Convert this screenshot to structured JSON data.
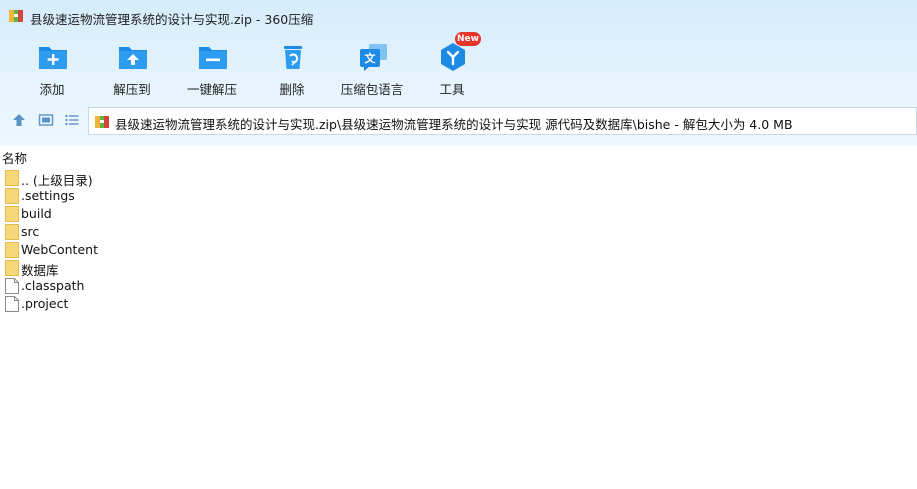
{
  "window": {
    "title": "县级速运物流管理系统的设计与实现.zip - 360压缩"
  },
  "toolbar": {
    "items": [
      {
        "label": "添加",
        "icon": "add-folder-icon"
      },
      {
        "label": "解压到",
        "icon": "extract-to-icon"
      },
      {
        "label": "一键解压",
        "icon": "one-click-extract-icon"
      },
      {
        "label": "删除",
        "icon": "recycle-bin-icon"
      },
      {
        "label": "压缩包语言",
        "icon": "language-icon"
      },
      {
        "label": "工具",
        "icon": "tools-icon"
      }
    ],
    "new_badge": "New"
  },
  "address": {
    "path": "县级速运物流管理系统的设计与实现.zip\\县级速运物流管理系统的设计与实现 源代码及数据库\\bishe - 解包大小为 4.0 MB"
  },
  "list": {
    "header_name": "名称",
    "files": [
      {
        "name": ".. (上级目录)",
        "type": "folder"
      },
      {
        "name": ".settings",
        "type": "folder"
      },
      {
        "name": "build",
        "type": "folder"
      },
      {
        "name": "src",
        "type": "folder"
      },
      {
        "name": "WebContent",
        "type": "folder"
      },
      {
        "name": "数据库",
        "type": "folder"
      },
      {
        "name": ".classpath",
        "type": "file"
      },
      {
        "name": ".project",
        "type": "file"
      }
    ]
  },
  "colors": {
    "accent": "#1d8be6",
    "toolbar_bg": "#d5ecfb",
    "folder": "#f6d77a",
    "badge": "#e8352b"
  }
}
